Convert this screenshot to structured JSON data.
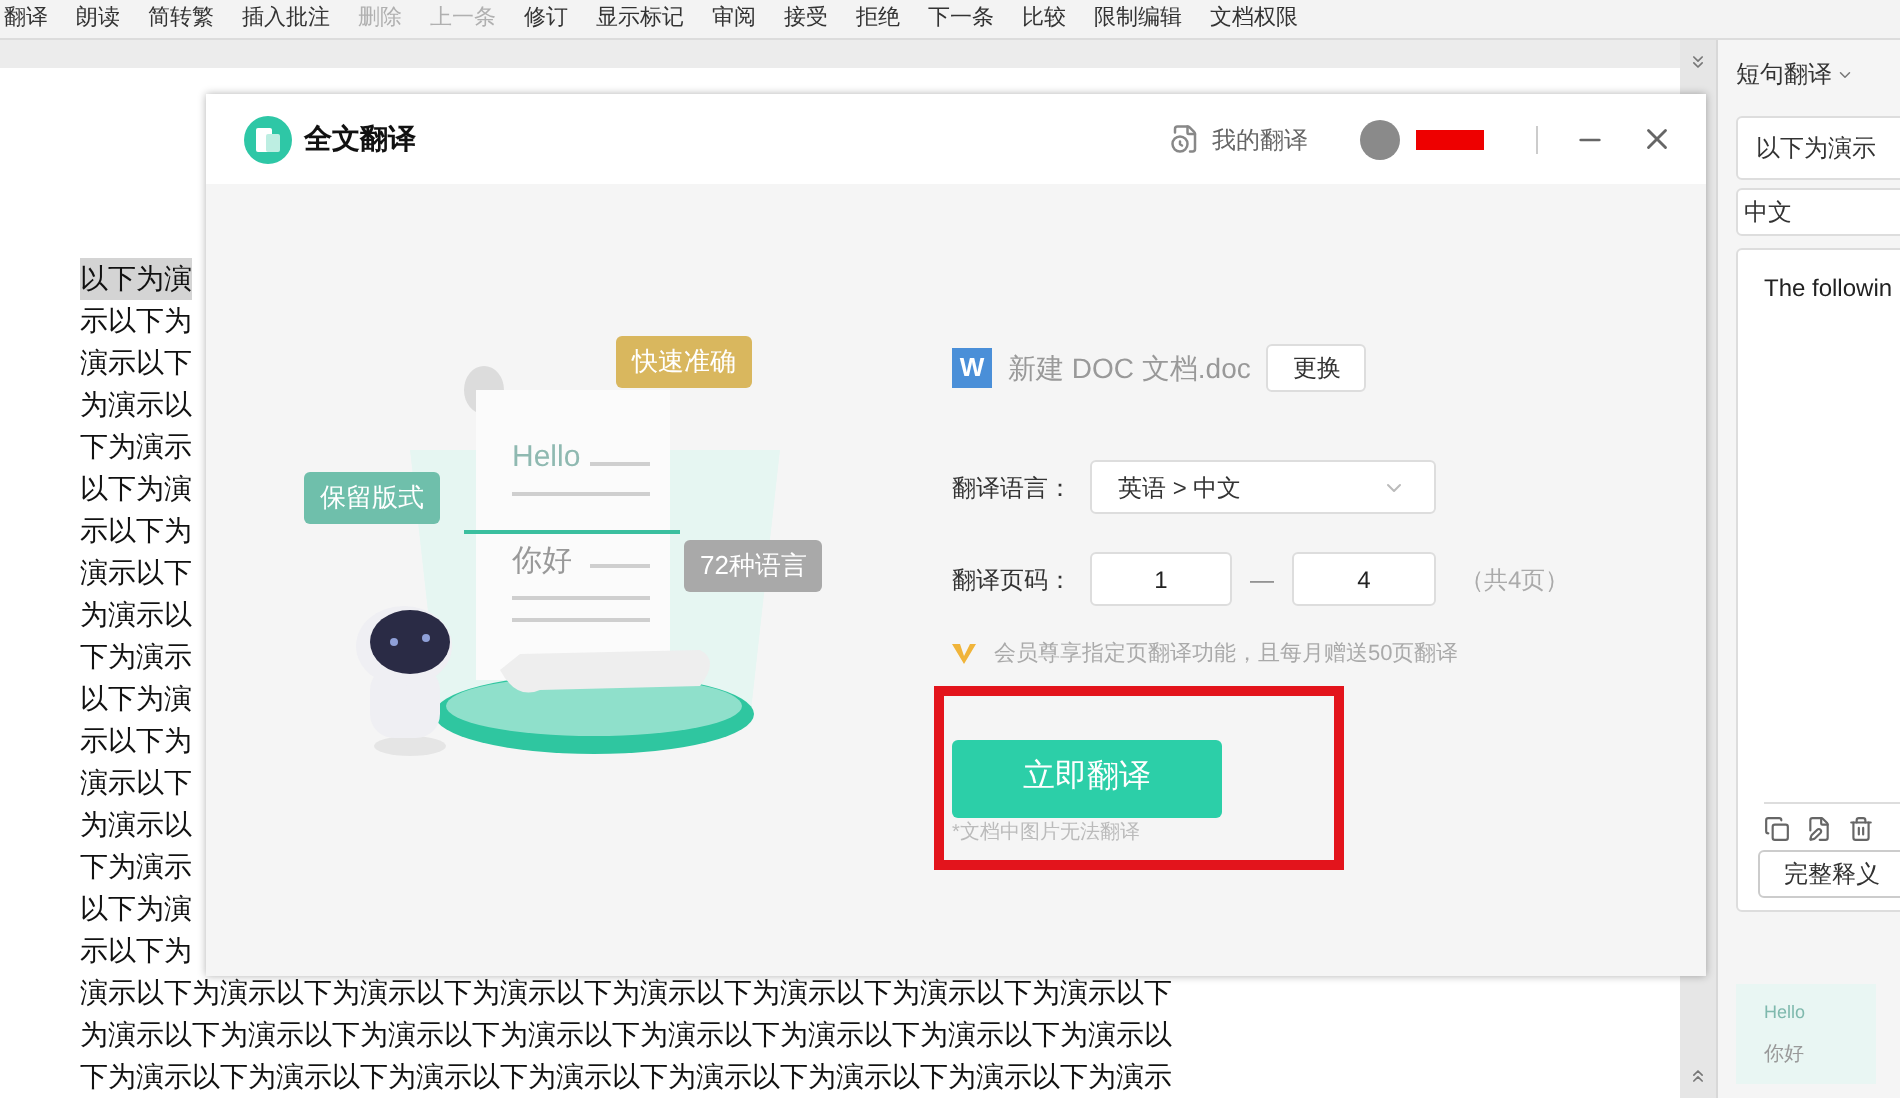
{
  "toolbar": {
    "items": [
      {
        "label": "翻译",
        "disabled": false
      },
      {
        "label": "朗读",
        "disabled": false
      },
      {
        "label": "简转繁",
        "disabled": false
      },
      {
        "label": "插入批注",
        "disabled": false
      },
      {
        "label": "删除",
        "disabled": true
      },
      {
        "label": "上一条",
        "disabled": true
      },
      {
        "label": "修订",
        "disabled": false
      },
      {
        "label": "显示标记",
        "disabled": false
      },
      {
        "label": "审阅",
        "disabled": false
      },
      {
        "label": "接受",
        "disabled": false
      },
      {
        "label": "拒绝",
        "disabled": false
      },
      {
        "label": "下一条",
        "disabled": false
      },
      {
        "label": "比较",
        "disabled": false
      },
      {
        "label": "限制编辑",
        "disabled": false
      },
      {
        "label": "文档权限",
        "disabled": false
      }
    ]
  },
  "document": {
    "lines": [
      {
        "text": "以下为演",
        "highlighted": true
      },
      {
        "text": "示以下为",
        "highlighted": false
      },
      {
        "text": "演示以下",
        "highlighted": false
      },
      {
        "text": "为演示以",
        "highlighted": false
      },
      {
        "text": "下为演示",
        "highlighted": false
      },
      {
        "text": "以下为演",
        "highlighted": false
      },
      {
        "text": "示以下为",
        "highlighted": false
      },
      {
        "text": "演示以下",
        "highlighted": false
      },
      {
        "text": "为演示以",
        "highlighted": false
      },
      {
        "text": "下为演示",
        "highlighted": false
      },
      {
        "text": "以下为演",
        "highlighted": false
      },
      {
        "text": "示以下为",
        "highlighted": false
      },
      {
        "text": "演示以下",
        "highlighted": false
      },
      {
        "text": "为演示以",
        "highlighted": false
      },
      {
        "text": "下为演示",
        "highlighted": false
      },
      {
        "text": "以下为演",
        "highlighted": false
      },
      {
        "text": "示以下为",
        "highlighted": false
      },
      {
        "text": "演示以下为演示以下为演示以下为演示以下为演示以下为演示以下为演示以下为演示以下",
        "highlighted": false
      },
      {
        "text": "为演示以下为演示以下为演示以下为演示以下为演示以下为演示以下为演示以下为演示以",
        "highlighted": false
      },
      {
        "text": "下为演示以下为演示以下为演示以下为演示以下为演示以下为演示以下为演示以下为演示",
        "highlighted": false
      }
    ]
  },
  "dialog": {
    "title": "全文翻译",
    "my_translations": "我的翻译",
    "illustration": {
      "bubbles": [
        {
          "text": "快速准确",
          "color": "#d9b75e"
        },
        {
          "text": "保留版式",
          "color": "#6fbfab"
        },
        {
          "text": "72种语言",
          "color": "#a9a9a9"
        }
      ],
      "source_word": "Hello",
      "target_word": "你好"
    },
    "file": {
      "icon_letter": "W",
      "name": "新建 DOC 文档.doc",
      "change_button": "更换"
    },
    "language": {
      "label": "翻译语言：",
      "value": "英语 > 中文"
    },
    "pages": {
      "label": "翻译页码：",
      "from": "1",
      "separator": "—",
      "to": "4",
      "total": "（共4页）"
    },
    "vip_note": "会员尊享指定页翻译功能，且每月赠送50页翻译",
    "translate_button": "立即翻译",
    "hint": "*文档中图片无法翻译"
  },
  "side_panel": {
    "title": "短句翻译",
    "source": "以下为演示",
    "target_language": "中文",
    "result": "The followin",
    "full_button": "完整释义",
    "thumbnail": {
      "source_word": "Hello",
      "target_word": "你好"
    }
  }
}
